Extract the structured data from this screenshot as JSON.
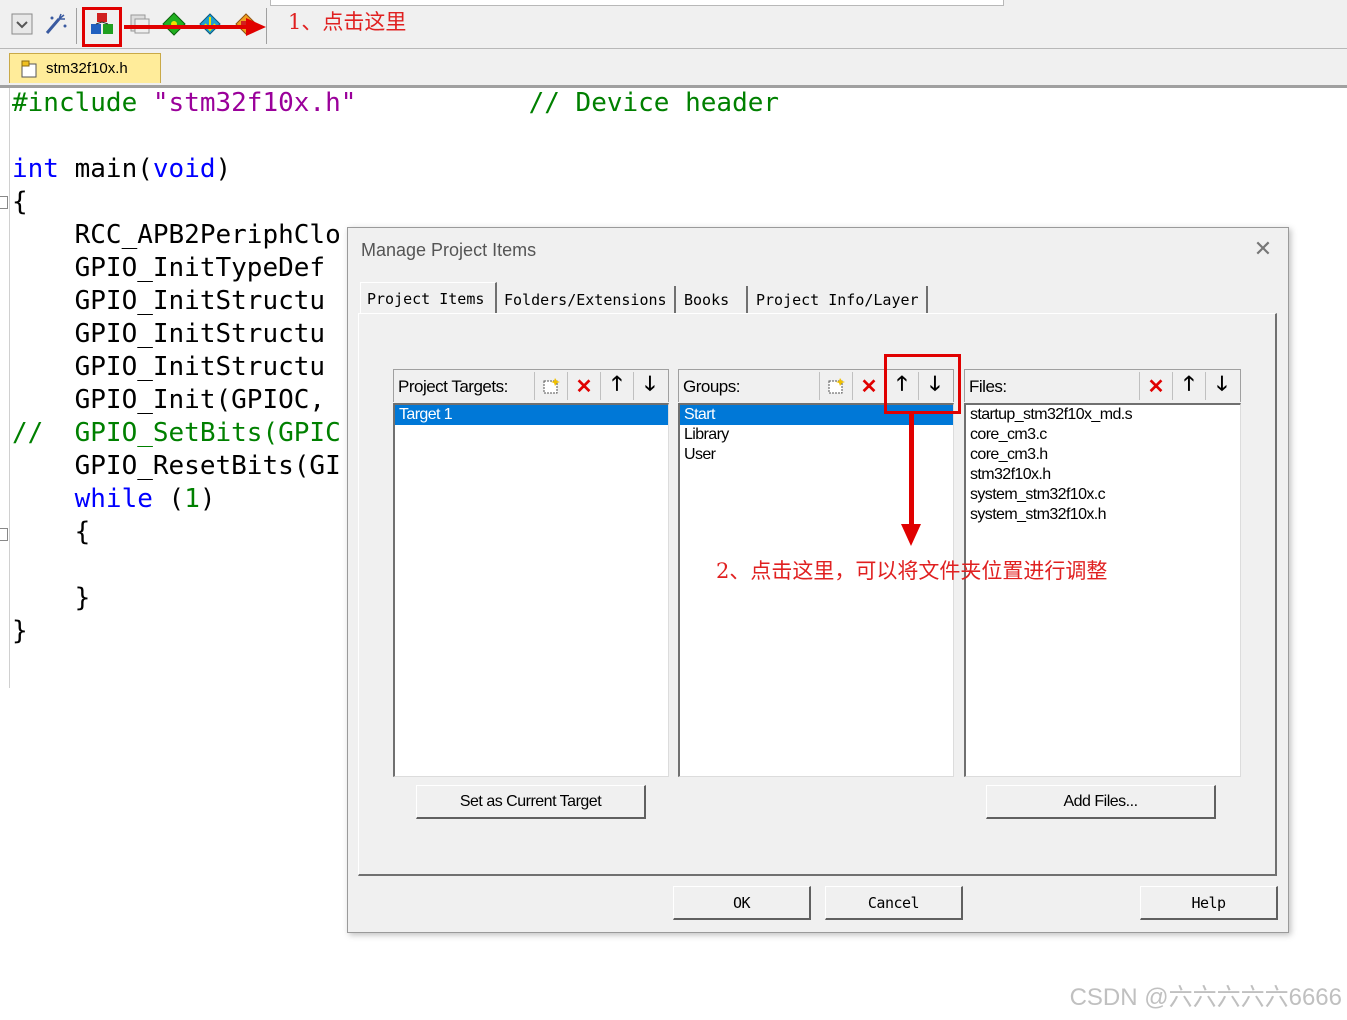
{
  "toolbar": {
    "icons": [
      "dropdown-icon",
      "magic-wand-icon",
      "manage-project-items-icon",
      "copy-icon",
      "green-diamond-icon",
      "diamond-download-icon",
      "load-icon"
    ]
  },
  "annotations": {
    "step1": "1、点击这里",
    "step2": "2、点击这里，可以将文件夹位置进行调整"
  },
  "editor": {
    "file_tab": "stm32f10x.h",
    "lines": {
      "l1_include": "#include",
      "l1_header": "\"stm32f10x.h\"",
      "l1_comment": "// Device header",
      "l3_int": "int",
      "l3_main": " main(",
      "l3_void": "void",
      "l3_close": ")",
      "l4": "{",
      "l5": "    RCC_APB2PeriphClo",
      "l6": "    GPIO_InitTypeDef",
      "l7": "    GPIO_InitStructu",
      "l8": "    GPIO_InitStructu",
      "l9": "    GPIO_InitStructu",
      "l10": "    GPIO_Init(GPIOC,",
      "l11_cmt": "//  GPIO_SetBits(GPIC",
      "l12": "    GPIO_ResetBits(GI",
      "l13_while": "while",
      "l13_num": "1",
      "l14": "    {",
      "l16": "    }",
      "l17": "}"
    }
  },
  "dialog": {
    "title": "Manage Project Items",
    "close": "✕",
    "tabs": [
      "Project Items",
      "Folders/Extensions",
      "Books",
      "Project Info/Layer"
    ],
    "targets": {
      "label": "Project Targets:",
      "items": [
        "Target 1"
      ],
      "selected": 0,
      "button": "Set as Current Target"
    },
    "groups": {
      "label": "Groups:",
      "items": [
        "Start",
        "Library",
        "User"
      ],
      "selected": 0
    },
    "files": {
      "label": "Files:",
      "items": [
        "startup_stm32f10x_md.s",
        "core_cm3.c",
        "core_cm3.h",
        "stm32f10x.h",
        "system_stm32f10x.c",
        "system_stm32f10x.h"
      ],
      "button": "Add Files..."
    },
    "buttons": {
      "ok": "OK",
      "cancel": "Cancel",
      "help": "Help"
    }
  },
  "watermark": "CSDN @六六六六六6666",
  "colors": {
    "annotation": "#e00000",
    "selection": "#0078d7",
    "keyword": "#0000ff",
    "string": "#9a009a",
    "comment": "#008000"
  }
}
